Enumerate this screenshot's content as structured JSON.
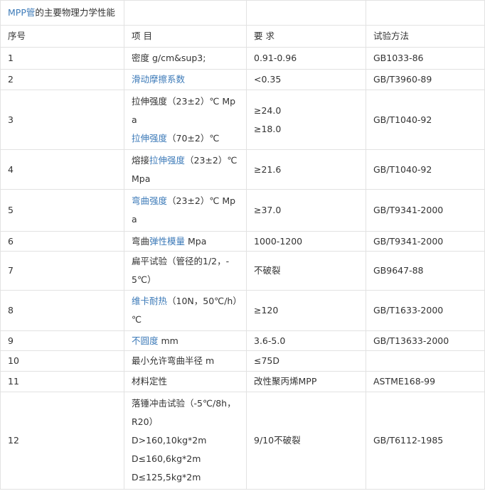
{
  "title": {
    "link": "MPP管",
    "rest": "的主要物理力学性能"
  },
  "headers": [
    "序号",
    "项 目",
    "要 求",
    "试验方法"
  ],
  "rows": [
    {
      "no": "1",
      "item": [
        [
          [
            "密度 g/cm&sup3;",
            false
          ]
        ]
      ],
      "req": [
        "0.91-0.96"
      ],
      "method": "GB1033-86"
    },
    {
      "no": "2",
      "item": [
        [
          [
            "滑动摩擦系数",
            true
          ]
        ]
      ],
      "req": [
        "<0.35"
      ],
      "method": "GB/T3960-89"
    },
    {
      "no": "3",
      "item": [
        [
          [
            "拉伸强度（23±2）℃ Mpa",
            false
          ]
        ],
        [
          [
            "拉伸强度",
            true
          ],
          [
            "（70±2）℃",
            false
          ]
        ]
      ],
      "req": [
        "≥24.0",
        "≥18.0"
      ],
      "method": "GB/T1040-92"
    },
    {
      "no": "4",
      "item": [
        [
          [
            "熔接",
            false
          ],
          [
            "拉伸强度",
            true
          ],
          [
            "（23±2）℃ Mpa",
            false
          ]
        ]
      ],
      "req": [
        "≥21.6"
      ],
      "method": "GB/T1040-92"
    },
    {
      "no": "5",
      "item": [
        [
          [
            "弯曲强度",
            true
          ],
          [
            "（23±2）℃ Mpa",
            false
          ]
        ]
      ],
      "req": [
        "≥37.0"
      ],
      "method": "GB/T9341-2000"
    },
    {
      "no": "6",
      "item": [
        [
          [
            "弯曲",
            false
          ],
          [
            "弹性模量",
            true
          ],
          [
            " Mpa",
            false
          ]
        ]
      ],
      "req": [
        "1000-1200"
      ],
      "method": "GB/T9341-2000"
    },
    {
      "no": "7",
      "item": [
        [
          [
            "扁平试验（管径的1/2，-5℃）",
            false
          ]
        ]
      ],
      "req": [
        "不破裂"
      ],
      "method": "GB9647-88"
    },
    {
      "no": "8",
      "item": [
        [
          [
            "维卡耐热",
            true
          ],
          [
            "（10N，50℃/h）℃",
            false
          ]
        ]
      ],
      "req": [
        "≥120"
      ],
      "method": "GB/T1633-2000"
    },
    {
      "no": "9",
      "item": [
        [
          [
            "不圆度",
            true
          ],
          [
            " mm",
            false
          ]
        ]
      ],
      "req": [
        "3.6-5.0"
      ],
      "method": "GB/T13633-2000"
    },
    {
      "no": "10",
      "item": [
        [
          [
            "最小允许弯曲半径 m",
            false
          ]
        ]
      ],
      "req": [
        "≤75D"
      ],
      "method": ""
    },
    {
      "no": "11",
      "item": [
        [
          [
            "材料定性",
            false
          ]
        ]
      ],
      "req": [
        "改性聚丙烯MPP"
      ],
      "method": "ASTME168-99"
    },
    {
      "no": "12",
      "item": [
        [
          [
            "落锤冲击试验（-5℃/8h，R20）",
            false
          ]
        ],
        [
          [
            "D>160,10kg*2m",
            false
          ]
        ],
        [
          [
            "D≤160,6kg*2m",
            false
          ]
        ],
        [
          [
            "D≤125,5kg*2m",
            false
          ]
        ]
      ],
      "req": [
        "9/10不破裂"
      ],
      "method": "GB/T6112-1985"
    }
  ]
}
